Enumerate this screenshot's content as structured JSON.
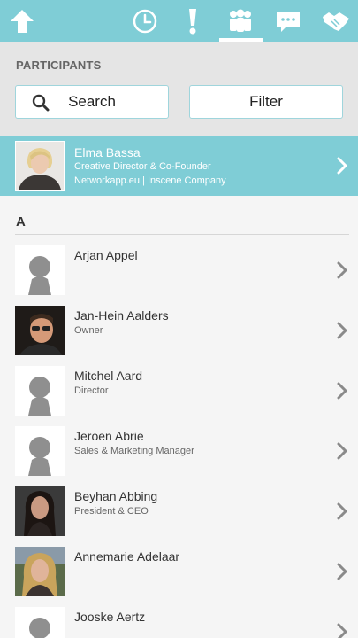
{
  "nav": {
    "icons": [
      "home-up-icon",
      "clock-icon",
      "alert-icon",
      "participants-icon",
      "chat-icon",
      "handshake-icon"
    ],
    "active_tab": "participants",
    "accent_color": "#7fcdd6"
  },
  "header": {
    "section_label": "PARTICIPANTS",
    "search_label": "Search",
    "filter_label": "Filter"
  },
  "featured": {
    "name": "Elma Bassa",
    "title": "Creative Director & Co-Founder",
    "company": "Networkapp.eu | Inscene Company"
  },
  "list": {
    "letter": "A",
    "people": [
      {
        "name": "Arjan Appel",
        "role": ""
      },
      {
        "name": "Jan-Hein Aalders",
        "role": "Owner"
      },
      {
        "name": "Mitchel Aard",
        "role": "Director"
      },
      {
        "name": "Jeroen Abrie",
        "role": "Sales & Marketing Manager"
      },
      {
        "name": "Beyhan Abbing",
        "role": "President & CEO"
      },
      {
        "name": "Annemarie Adelaar",
        "role": ""
      },
      {
        "name": "Jooske Aertz",
        "role": ""
      }
    ]
  }
}
